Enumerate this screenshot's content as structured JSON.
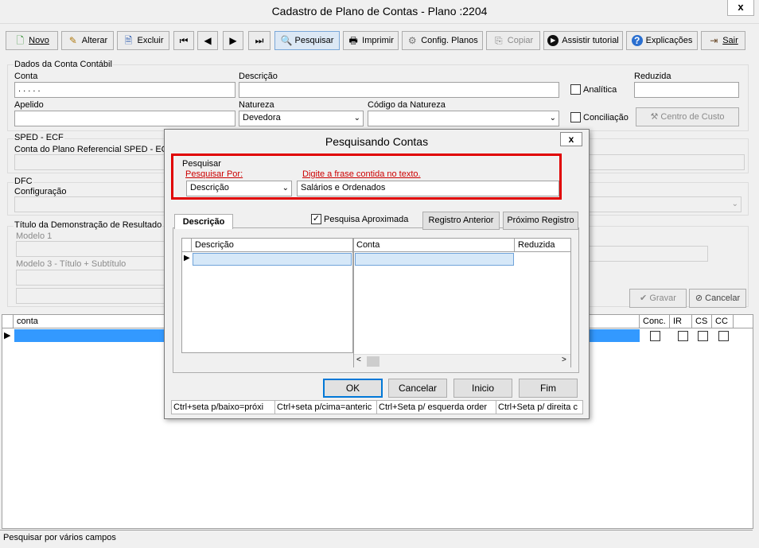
{
  "window": {
    "title": "Cadastro de Plano de Contas - Plano :2204",
    "close": "x"
  },
  "toolbar": {
    "novo": "Novo",
    "alterar": "Alterar",
    "excluir": "Excluir",
    "pesquisar": "Pesquisar",
    "imprimir": "Imprimir",
    "config": "Config. Planos",
    "copiar": "Copiar",
    "tutorial": "Assistir tutorial",
    "explicacoes": "Explicações",
    "sair": "Sair"
  },
  "form": {
    "group_title": "Dados da Conta Contábil",
    "conta_label": "Conta",
    "conta_value": ". . . . .",
    "descricao_label": "Descrição",
    "analitica_label": "Analítica",
    "reduzida_label": "Reduzida",
    "apelido_label": "Apelido",
    "natureza_label": "Natureza",
    "natureza_value": "Devedora",
    "codigo_natureza_label": "Código da Natureza",
    "conciliacao_label": "Conciliação",
    "centro_custo_label": "Centro de Custo",
    "sped_title": "SPED - ECF",
    "sped_conta_label": "Conta do Plano Referencial SPED - ECF",
    "dfc_title": "DFC",
    "dfc_config_label": "Configuração",
    "titulo_dem_label": "Título da Demonstração de Resultado",
    "modelo1_label": "Modelo 1",
    "modelo3_label": "Modelo 3 - Título + Subtítulo",
    "gravar": "Gravar",
    "cancelar": "Cancelar"
  },
  "grid": {
    "col_conta": "conta",
    "col_conc": "Conc.",
    "col_ir": "IR",
    "col_cs": "CS",
    "col_cc": "CC"
  },
  "status": "Pesquisar por vários campos",
  "dialog": {
    "title": "Pesquisando Contas",
    "close": "x",
    "group": "Pesquisar",
    "pesquisar_por_label": "Pesquisar Por:",
    "pesquisar_por_value": "Descrição",
    "frase_label": "Digite a frase contida no texto.",
    "frase_value": "Salários e Ordenados",
    "tab": "Descrição",
    "aproximada_label": "Pesquisa Aproximada",
    "registro_anterior": "Registro Anterior",
    "proximo_registro": "Próximo Registro",
    "col_descricao": "Descrição",
    "col_conta": "Conta",
    "col_reduzida": "Reduzida",
    "ok": "OK",
    "cancelar": "Cancelar",
    "inicio": "Inicio",
    "fim": "Fim",
    "hints": [
      "Ctrl+seta p/baixo=próxi",
      "Ctrl+seta p/cima=anteric",
      "Ctrl+Seta p/ esquerda order",
      "Ctrl+Seta p/ direita c"
    ]
  },
  "colors": {
    "selection": "#3399ff",
    "highlight_box": "#e00000",
    "red_label": "#cc0000"
  }
}
